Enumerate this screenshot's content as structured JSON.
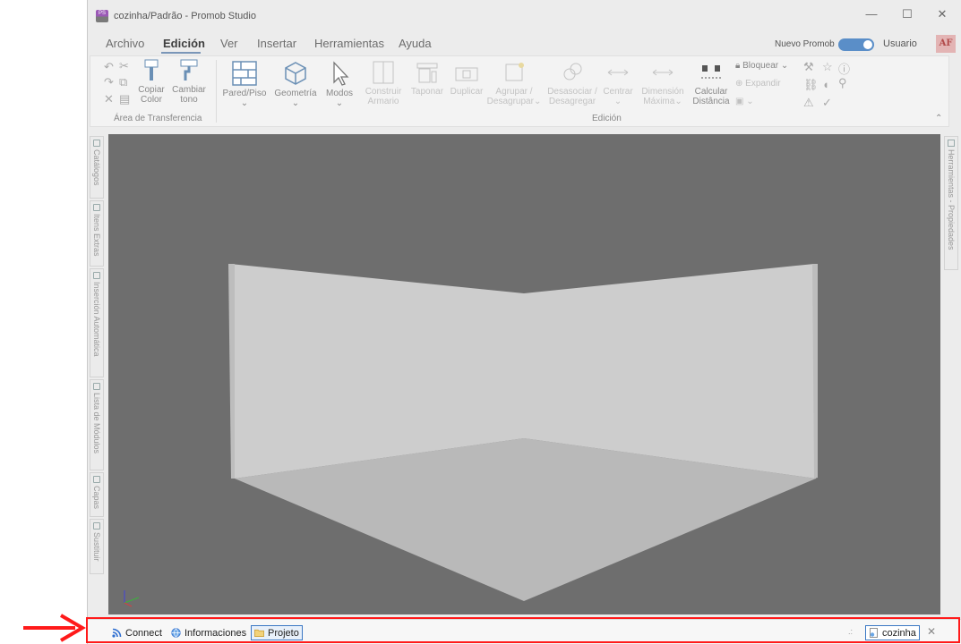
{
  "window": {
    "title": "cozinha/Padrão - Promob Studio",
    "app_icon_text": "PS",
    "controls": {
      "minimize": "—",
      "maximize": "☐",
      "close": "✕"
    }
  },
  "menu": {
    "items": [
      "Archivo",
      "Edición",
      "Ver",
      "Insertar",
      "Herramientas",
      "Ayuda"
    ],
    "active": "Edición",
    "nuevo_promob_label": "Nuevo Promob",
    "nuevo_promob_on": true,
    "user_label": "Usuario",
    "avatar_initials": "AF"
  },
  "ribbon": {
    "transfer_group": {
      "label": "Área de Transferencia",
      "copy_color": [
        "Copiar",
        "Color"
      ],
      "change_tone": [
        "Cambiar",
        "tono"
      ]
    },
    "edit_group": {
      "label": "Edición",
      "wall_floor": "Pared/Piso",
      "geometry": "Geometría",
      "modes": "Modos",
      "build_cabinet": [
        "Construir",
        "Armario"
      ],
      "cover": "Taponar",
      "duplicate": "Duplicar",
      "group_ungroup": [
        "Agrupar /",
        "Desagrupar"
      ],
      "dissociate": [
        "Desasociar /",
        "Desagregar"
      ],
      "center": "Centrar",
      "max_dimension": [
        "Dimensión",
        "Máxima"
      ],
      "calc_distance": [
        "Calcular",
        "Distância"
      ],
      "lock": "Bloquear",
      "expand": "Expandir"
    },
    "collapse_glyph": "⌃"
  },
  "left_panels": [
    {
      "label": "Catálogos"
    },
    {
      "label": "Itens Extras"
    },
    {
      "label": "Inserción Automática"
    },
    {
      "label": "Lista de Módulos"
    },
    {
      "label": "Capas"
    },
    {
      "label": "Sustituir"
    }
  ],
  "right_panels": {
    "label": "Herramientas - Propiedades"
  },
  "statusbar": {
    "connect": "Connect",
    "info": "Informaciones",
    "project": "Projeto",
    "grip": ".:",
    "document": "cozinha",
    "close": "✕"
  },
  "colors": {
    "viewport_bg": "#6e6e6e",
    "wall": "#c8c8c8",
    "floor": "#b9b9b9",
    "highlight": "#ff1a1a",
    "toggle": "#5a8ec8"
  }
}
